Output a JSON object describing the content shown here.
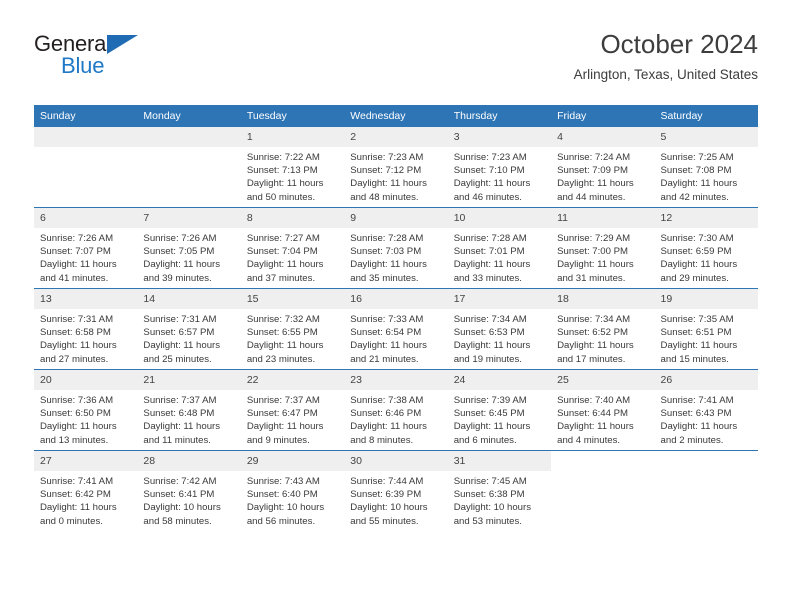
{
  "brand": {
    "line1": "General",
    "line2": "Blue",
    "triangle_color": "#1f6cb4",
    "text_color": "#231f20",
    "blue_text_color": "#2079c6"
  },
  "header": {
    "title": "October 2024",
    "subtitle": "Arlington, Texas, United States"
  },
  "theme": {
    "header_bg": "#2e75b6",
    "header_text": "#ffffff",
    "daynum_bg": "#efefef",
    "row_divider": "#2e75b6",
    "body_text": "#3a3a3a"
  },
  "calendar": {
    "weekday_headers": [
      "Sunday",
      "Monday",
      "Tuesday",
      "Wednesday",
      "Thursday",
      "Friday",
      "Saturday"
    ],
    "weeks": [
      [
        {
          "day": "",
          "sunrise": "",
          "sunset": "",
          "daylight1": "",
          "daylight2": "",
          "empty": true
        },
        {
          "day": "",
          "sunrise": "",
          "sunset": "",
          "daylight1": "",
          "daylight2": "",
          "empty": true
        },
        {
          "day": "1",
          "sunrise": "Sunrise: 7:22 AM",
          "sunset": "Sunset: 7:13 PM",
          "daylight1": "Daylight: 11 hours",
          "daylight2": "and 50 minutes."
        },
        {
          "day": "2",
          "sunrise": "Sunrise: 7:23 AM",
          "sunset": "Sunset: 7:12 PM",
          "daylight1": "Daylight: 11 hours",
          "daylight2": "and 48 minutes."
        },
        {
          "day": "3",
          "sunrise": "Sunrise: 7:23 AM",
          "sunset": "Sunset: 7:10 PM",
          "daylight1": "Daylight: 11 hours",
          "daylight2": "and 46 minutes."
        },
        {
          "day": "4",
          "sunrise": "Sunrise: 7:24 AM",
          "sunset": "Sunset: 7:09 PM",
          "daylight1": "Daylight: 11 hours",
          "daylight2": "and 44 minutes."
        },
        {
          "day": "5",
          "sunrise": "Sunrise: 7:25 AM",
          "sunset": "Sunset: 7:08 PM",
          "daylight1": "Daylight: 11 hours",
          "daylight2": "and 42 minutes."
        }
      ],
      [
        {
          "day": "6",
          "sunrise": "Sunrise: 7:26 AM",
          "sunset": "Sunset: 7:07 PM",
          "daylight1": "Daylight: 11 hours",
          "daylight2": "and 41 minutes."
        },
        {
          "day": "7",
          "sunrise": "Sunrise: 7:26 AM",
          "sunset": "Sunset: 7:05 PM",
          "daylight1": "Daylight: 11 hours",
          "daylight2": "and 39 minutes."
        },
        {
          "day": "8",
          "sunrise": "Sunrise: 7:27 AM",
          "sunset": "Sunset: 7:04 PM",
          "daylight1": "Daylight: 11 hours",
          "daylight2": "and 37 minutes."
        },
        {
          "day": "9",
          "sunrise": "Sunrise: 7:28 AM",
          "sunset": "Sunset: 7:03 PM",
          "daylight1": "Daylight: 11 hours",
          "daylight2": "and 35 minutes."
        },
        {
          "day": "10",
          "sunrise": "Sunrise: 7:28 AM",
          "sunset": "Sunset: 7:01 PM",
          "daylight1": "Daylight: 11 hours",
          "daylight2": "and 33 minutes."
        },
        {
          "day": "11",
          "sunrise": "Sunrise: 7:29 AM",
          "sunset": "Sunset: 7:00 PM",
          "daylight1": "Daylight: 11 hours",
          "daylight2": "and 31 minutes."
        },
        {
          "day": "12",
          "sunrise": "Sunrise: 7:30 AM",
          "sunset": "Sunset: 6:59 PM",
          "daylight1": "Daylight: 11 hours",
          "daylight2": "and 29 minutes."
        }
      ],
      [
        {
          "day": "13",
          "sunrise": "Sunrise: 7:31 AM",
          "sunset": "Sunset: 6:58 PM",
          "daylight1": "Daylight: 11 hours",
          "daylight2": "and 27 minutes."
        },
        {
          "day": "14",
          "sunrise": "Sunrise: 7:31 AM",
          "sunset": "Sunset: 6:57 PM",
          "daylight1": "Daylight: 11 hours",
          "daylight2": "and 25 minutes."
        },
        {
          "day": "15",
          "sunrise": "Sunrise: 7:32 AM",
          "sunset": "Sunset: 6:55 PM",
          "daylight1": "Daylight: 11 hours",
          "daylight2": "and 23 minutes."
        },
        {
          "day": "16",
          "sunrise": "Sunrise: 7:33 AM",
          "sunset": "Sunset: 6:54 PM",
          "daylight1": "Daylight: 11 hours",
          "daylight2": "and 21 minutes."
        },
        {
          "day": "17",
          "sunrise": "Sunrise: 7:34 AM",
          "sunset": "Sunset: 6:53 PM",
          "daylight1": "Daylight: 11 hours",
          "daylight2": "and 19 minutes."
        },
        {
          "day": "18",
          "sunrise": "Sunrise: 7:34 AM",
          "sunset": "Sunset: 6:52 PM",
          "daylight1": "Daylight: 11 hours",
          "daylight2": "and 17 minutes."
        },
        {
          "day": "19",
          "sunrise": "Sunrise: 7:35 AM",
          "sunset": "Sunset: 6:51 PM",
          "daylight1": "Daylight: 11 hours",
          "daylight2": "and 15 minutes."
        }
      ],
      [
        {
          "day": "20",
          "sunrise": "Sunrise: 7:36 AM",
          "sunset": "Sunset: 6:50 PM",
          "daylight1": "Daylight: 11 hours",
          "daylight2": "and 13 minutes."
        },
        {
          "day": "21",
          "sunrise": "Sunrise: 7:37 AM",
          "sunset": "Sunset: 6:48 PM",
          "daylight1": "Daylight: 11 hours",
          "daylight2": "and 11 minutes."
        },
        {
          "day": "22",
          "sunrise": "Sunrise: 7:37 AM",
          "sunset": "Sunset: 6:47 PM",
          "daylight1": "Daylight: 11 hours",
          "daylight2": "and 9 minutes."
        },
        {
          "day": "23",
          "sunrise": "Sunrise: 7:38 AM",
          "sunset": "Sunset: 6:46 PM",
          "daylight1": "Daylight: 11 hours",
          "daylight2": "and 8 minutes."
        },
        {
          "day": "24",
          "sunrise": "Sunrise: 7:39 AM",
          "sunset": "Sunset: 6:45 PM",
          "daylight1": "Daylight: 11 hours",
          "daylight2": "and 6 minutes."
        },
        {
          "day": "25",
          "sunrise": "Sunrise: 7:40 AM",
          "sunset": "Sunset: 6:44 PM",
          "daylight1": "Daylight: 11 hours",
          "daylight2": "and 4 minutes."
        },
        {
          "day": "26",
          "sunrise": "Sunrise: 7:41 AM",
          "sunset": "Sunset: 6:43 PM",
          "daylight1": "Daylight: 11 hours",
          "daylight2": "and 2 minutes."
        }
      ],
      [
        {
          "day": "27",
          "sunrise": "Sunrise: 7:41 AM",
          "sunset": "Sunset: 6:42 PM",
          "daylight1": "Daylight: 11 hours",
          "daylight2": "and 0 minutes."
        },
        {
          "day": "28",
          "sunrise": "Sunrise: 7:42 AM",
          "sunset": "Sunset: 6:41 PM",
          "daylight1": "Daylight: 10 hours",
          "daylight2": "and 58 minutes."
        },
        {
          "day": "29",
          "sunrise": "Sunrise: 7:43 AM",
          "sunset": "Sunset: 6:40 PM",
          "daylight1": "Daylight: 10 hours",
          "daylight2": "and 56 minutes."
        },
        {
          "day": "30",
          "sunrise": "Sunrise: 7:44 AM",
          "sunset": "Sunset: 6:39 PM",
          "daylight1": "Daylight: 10 hours",
          "daylight2": "and 55 minutes."
        },
        {
          "day": "31",
          "sunrise": "Sunrise: 7:45 AM",
          "sunset": "Sunset: 6:38 PM",
          "daylight1": "Daylight: 10 hours",
          "daylight2": "and 53 minutes."
        },
        {
          "day": "",
          "sunrise": "",
          "sunset": "",
          "daylight1": "",
          "daylight2": "",
          "blank": true
        },
        {
          "day": "",
          "sunrise": "",
          "sunset": "",
          "daylight1": "",
          "daylight2": "",
          "blank": true
        }
      ]
    ]
  }
}
